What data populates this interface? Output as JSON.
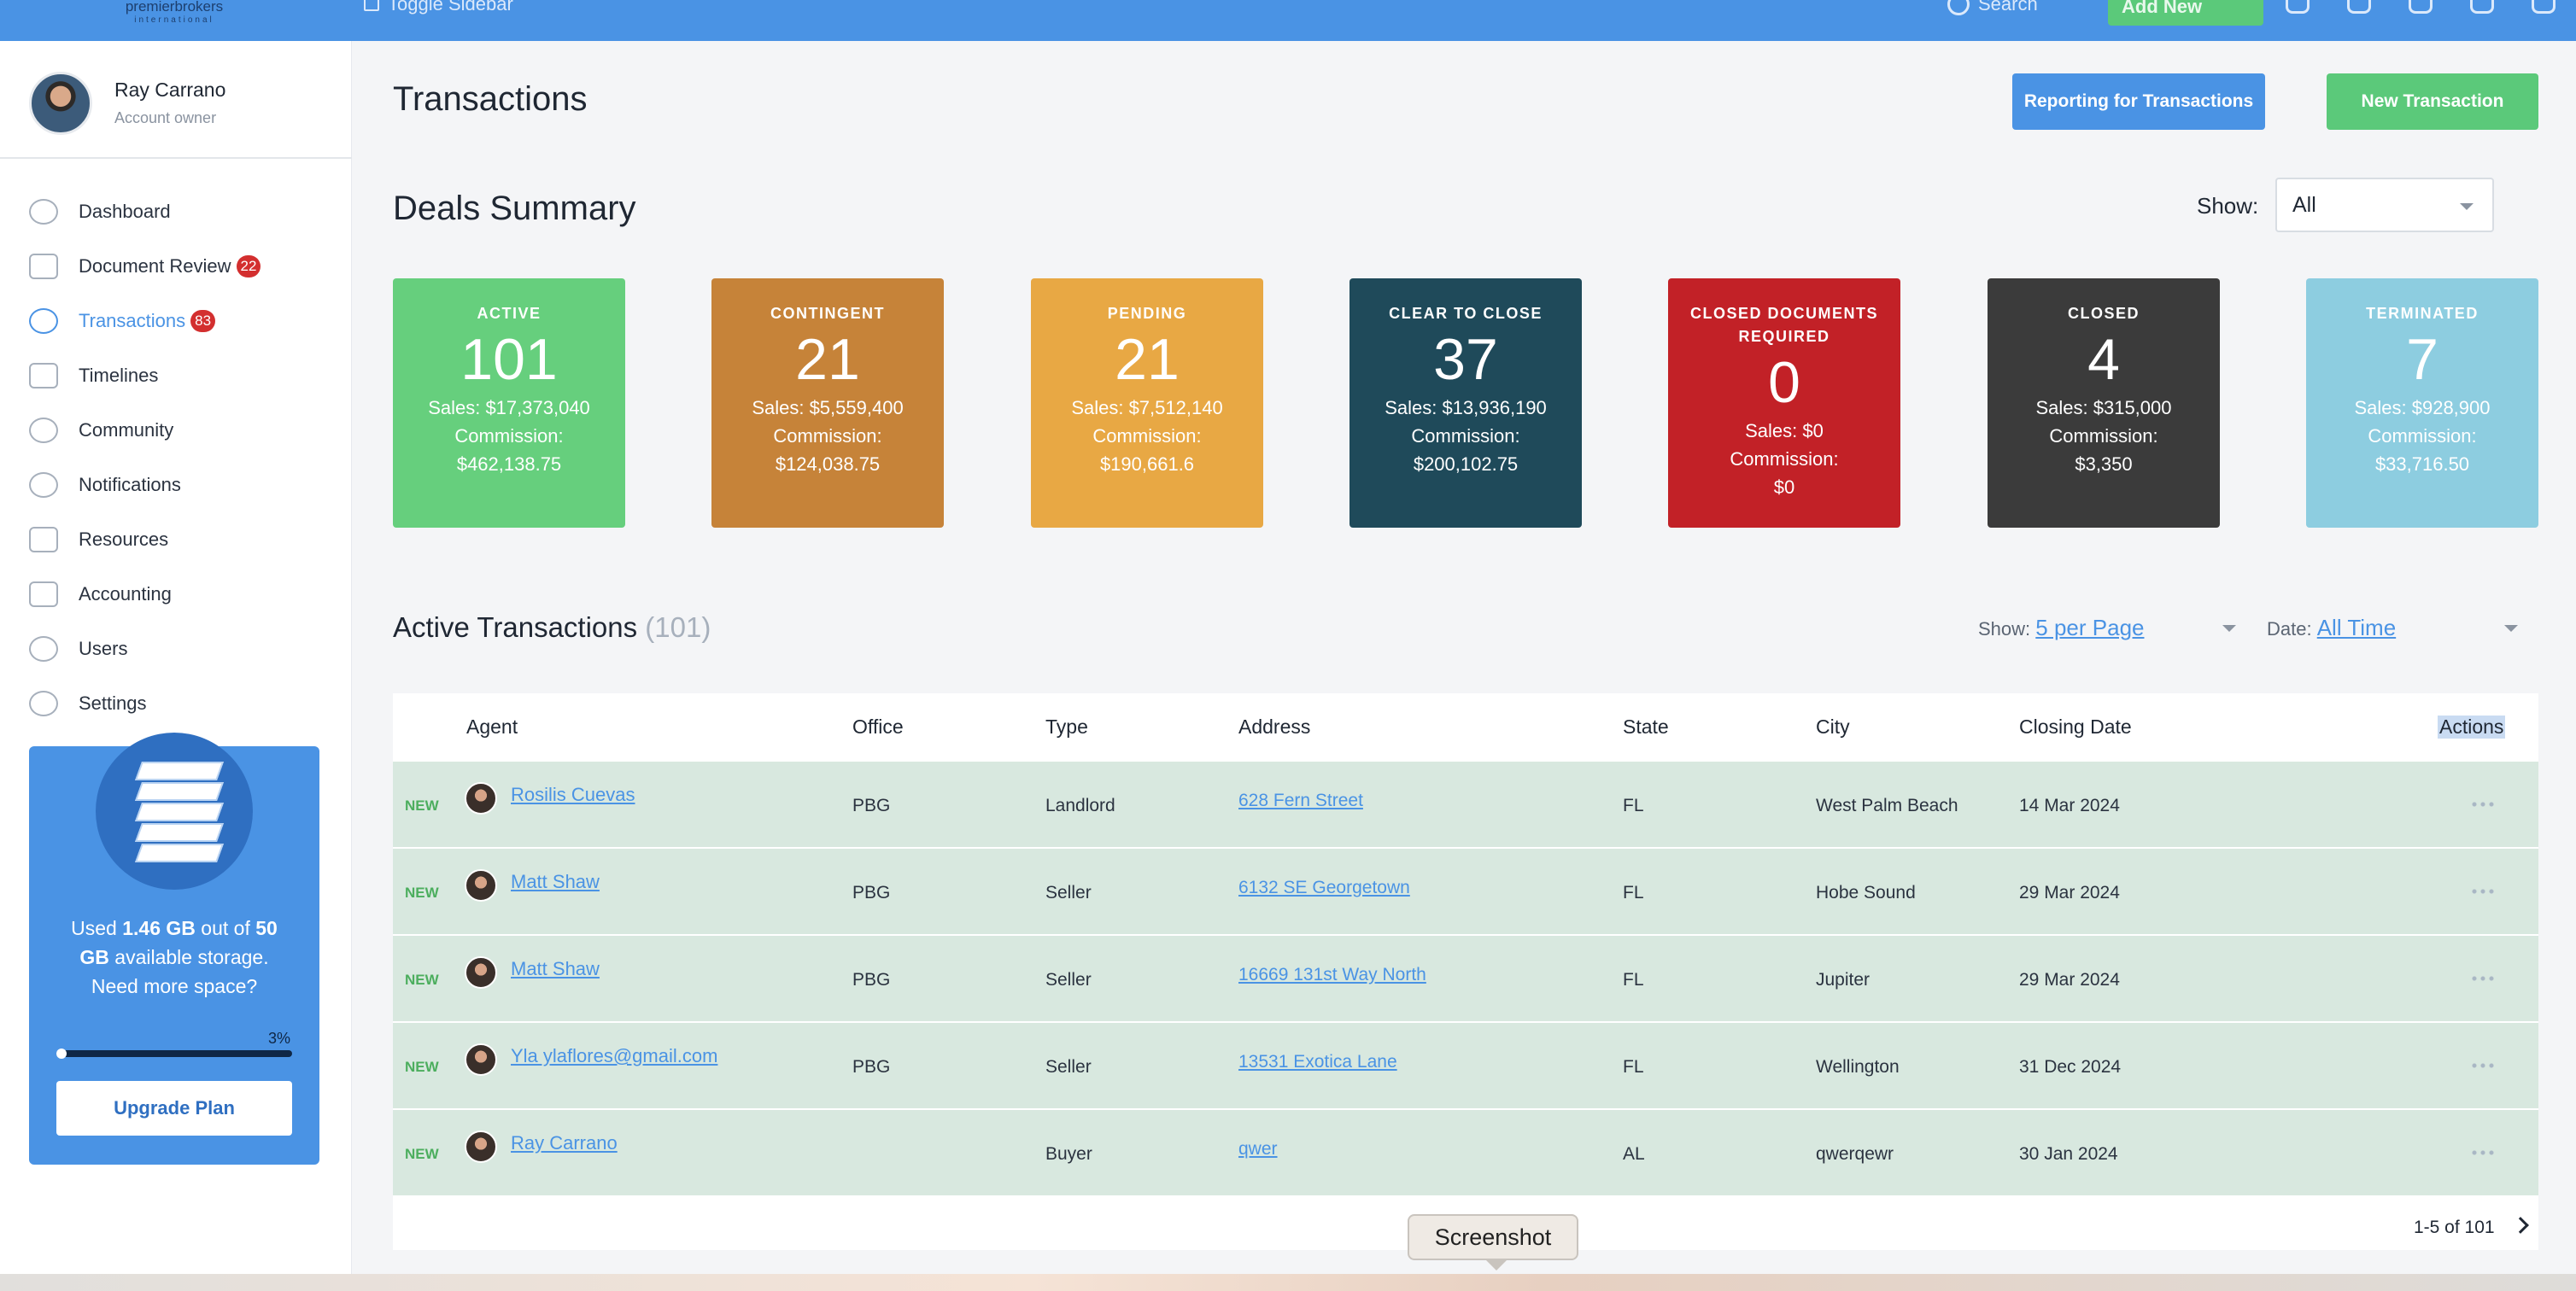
{
  "topbar": {
    "logo_text": "premierbrokers",
    "logo_sub": "international",
    "toggle_label": "Toggle Sidebar",
    "search_label": "Search",
    "add_new_label": "Add New"
  },
  "sidebar": {
    "user_name": "Ray Carrano",
    "user_role": "Account owner",
    "items": [
      {
        "label": "Dashboard",
        "badge": ""
      },
      {
        "label": "Document Review",
        "badge": "22"
      },
      {
        "label": "Transactions",
        "badge": "83"
      },
      {
        "label": "Timelines",
        "badge": ""
      },
      {
        "label": "Community",
        "badge": ""
      },
      {
        "label": "Notifications",
        "badge": ""
      },
      {
        "label": "Resources",
        "badge": ""
      },
      {
        "label": "Accounting",
        "badge": ""
      },
      {
        "label": "Users",
        "badge": ""
      },
      {
        "label": "Settings",
        "badge": ""
      }
    ],
    "storage": {
      "used_prefix": "Used",
      "used": "1.46 GB",
      "out_of": "out of",
      "total": "50 GB",
      "suffix": "available storage. Need more space?",
      "percent_label": "3%",
      "percent": 0.03,
      "upgrade_label": "Upgrade Plan"
    }
  },
  "header": {
    "title": "Transactions",
    "report_button": "Reporting for Transactions",
    "new_button": "New Transaction"
  },
  "summary": {
    "title": "Deals Summary",
    "show_label": "Show:",
    "show_value": "All",
    "cards": [
      {
        "label": "ACTIVE",
        "count": "101",
        "sales": "Sales: $17,373,040",
        "commission_label": "Commission:",
        "commission": "$462,138.75",
        "color": "#66cf7d"
      },
      {
        "label": "CONTINGENT",
        "count": "21",
        "sales": "Sales: $5,559,400",
        "commission_label": "Commission:",
        "commission": "$124,038.75",
        "color": "#c68339"
      },
      {
        "label": "PENDING",
        "count": "21",
        "sales": "Sales: $7,512,140",
        "commission_label": "Commission:",
        "commission": "$190,661.6",
        "color": "#e8a844"
      },
      {
        "label": "CLEAR TO CLOSE",
        "count": "37",
        "sales": "Sales: $13,936,190",
        "commission_label": "Commission:",
        "commission": "$200,102.75",
        "color": "#1f4a5a"
      },
      {
        "label": "CLOSED DOCUMENTS REQUIRED",
        "count": "0",
        "sales": "Sales: $0",
        "commission_label": "Commission:",
        "commission": "$0",
        "color": "#c22127"
      },
      {
        "label": "CLOSED",
        "count": "4",
        "sales": "Sales: $315,000",
        "commission_label": "Commission:",
        "commission": "$3,350",
        "color": "#3b3b3b"
      },
      {
        "label": "TERMINATED",
        "count": "7",
        "sales": "Sales: $928,900",
        "commission_label": "Commission:",
        "commission": "$33,716.50",
        "color": "#8dcde0"
      }
    ]
  },
  "active": {
    "title": "Active Transactions",
    "count": "(101)",
    "show_label": "Show:",
    "per_page": "5 per Page",
    "date_label": "Date:",
    "date_value": "All Time",
    "columns": [
      "Agent",
      "Office",
      "Type",
      "Address",
      "State",
      "City",
      "Closing Date",
      "Actions"
    ],
    "rows": [
      {
        "status": "NEW",
        "agent": "Rosilis Cuevas",
        "office": "PBG",
        "type": "Landlord",
        "address": "628 Fern Street",
        "state": "FL",
        "city": "West Palm Beach",
        "closing": "14 Mar 2024"
      },
      {
        "status": "NEW",
        "agent": "Matt Shaw",
        "office": "PBG",
        "type": "Seller",
        "address": "6132 SE Georgetown",
        "state": "FL",
        "city": "Hobe Sound",
        "closing": "29 Mar 2024"
      },
      {
        "status": "NEW",
        "agent": "Matt Shaw",
        "office": "PBG",
        "type": "Seller",
        "address": "16669 131st Way North",
        "state": "FL",
        "city": "Jupiter",
        "closing": "29 Mar 2024"
      },
      {
        "status": "NEW",
        "agent": "Yla ylaflores@gmail.com",
        "office": "PBG",
        "type": "Seller",
        "address": "13531 Exotica Lane",
        "state": "FL",
        "city": "Wellington",
        "closing": "31 Dec 2024"
      },
      {
        "status": "NEW",
        "agent": "Ray Carrano",
        "office": "",
        "type": "Buyer",
        "address": "qwer",
        "state": "AL",
        "city": "qwerqewr",
        "closing": "30 Jan 2024"
      }
    ],
    "pager": "1-5 of 101"
  },
  "tooltip": "Screenshot"
}
